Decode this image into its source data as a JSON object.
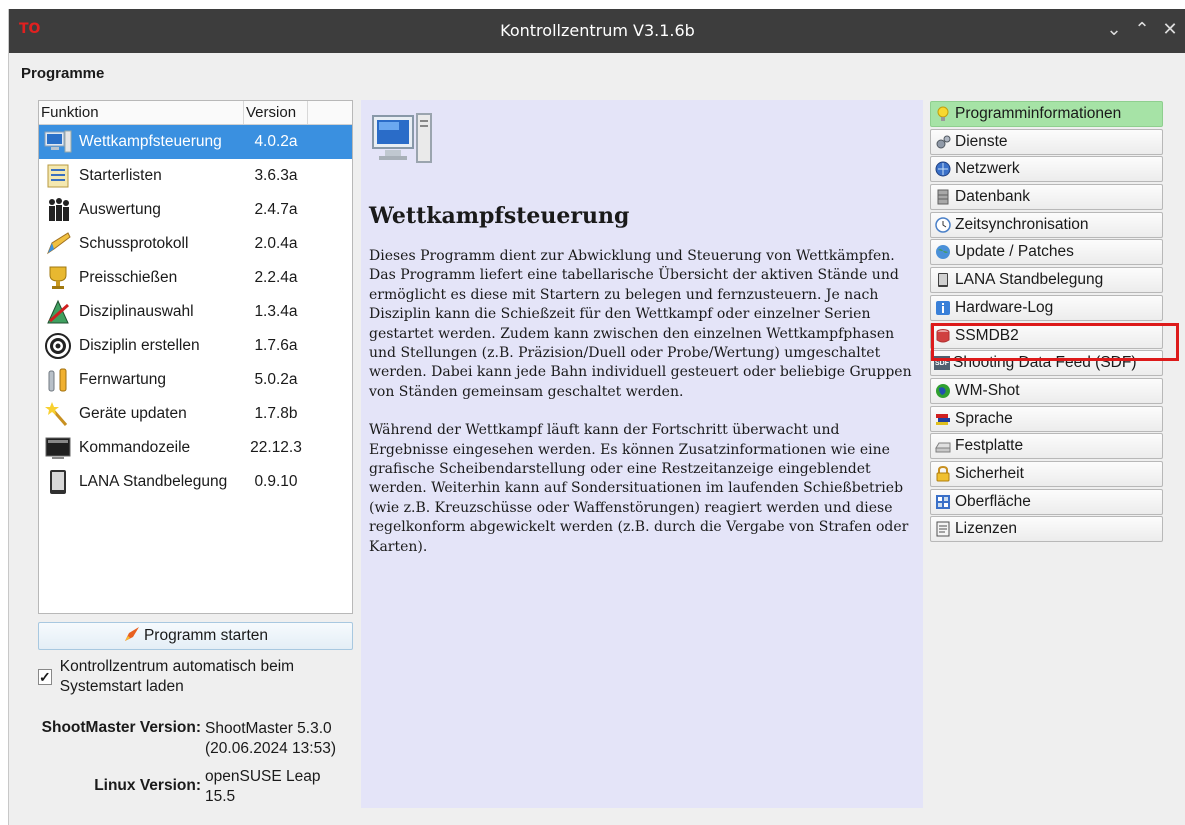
{
  "window": {
    "title": "Kontrollzentrum V3.1.6b",
    "app_icon_text": "TO",
    "controls": [
      "⌄",
      "⌃",
      "✕"
    ]
  },
  "group_title": "Programme",
  "program_list": {
    "headers": {
      "function": "Funktion",
      "version": "Version"
    },
    "rows": [
      {
        "name": "Wettkampfsteuerung",
        "version": "4.0.2a",
        "icon": "computer-icon",
        "selected": true
      },
      {
        "name": "Starterlisten",
        "version": "3.6.3a",
        "icon": "list-icon"
      },
      {
        "name": "Auswertung",
        "version": "2.4.7a",
        "icon": "podium-icon"
      },
      {
        "name": "Schussprotokoll",
        "version": "2.0.4a",
        "icon": "pencil-icon"
      },
      {
        "name": "Preisschießen",
        "version": "2.2.4a",
        "icon": "trophy-icon"
      },
      {
        "name": "Disziplinauswahl",
        "version": "1.3.4a",
        "icon": "target-arrow-icon"
      },
      {
        "name": "Disziplin erstellen",
        "version": "1.7.6a",
        "icon": "target-icon"
      },
      {
        "name": "Fernwartung",
        "version": "5.0.2a",
        "icon": "wrench-icon"
      },
      {
        "name": "Geräte updaten",
        "version": "1.7.8b",
        "icon": "magic-wand-icon"
      },
      {
        "name": "Kommandozeile",
        "version": "22.12.3",
        "icon": "terminal-icon"
      },
      {
        "name": "LANA Standbelegung",
        "version": "0.9.10",
        "icon": "tablet-icon"
      }
    ]
  },
  "start_button": "Programm starten",
  "autostart": {
    "label": "Kontrollzentrum automatisch beim Systemstart laden",
    "checked": true
  },
  "shootmaster": {
    "label": "ShootMaster Version:",
    "value_line1": "ShootMaster 5.3.0",
    "value_line2": "(20.06.2024 13:53)"
  },
  "linux": {
    "label": "Linux Version:",
    "value_line1": "openSUSE Leap",
    "value_line2": "15.5"
  },
  "info": {
    "title": "Wettkampfsteuerung",
    "paragraph1": "Dieses Programm dient zur Abwicklung und Steuerung von Wettkämpfen. Das Programm liefert eine tabellarische Übersicht der aktiven Stände und ermöglicht es diese mit Startern zu belegen und fernzusteuern. Je nach Disziplin kann die Schießzeit für den Wettkampf oder einzelner Serien gestartet werden. Zudem kann zwischen den einzelnen Wettkampfphasen und Stellungen (z.B. Präzision/Duell oder Probe/Wertung) umgeschaltet werden. Dabei kann jede Bahn individuell gesteuert oder beliebige Gruppen von Ständen gemeinsam geschaltet werden.",
    "paragraph2": "Während der Wettkampf läuft kann der Fortschritt überwacht und Ergebnisse eingesehen werden. Es können Zusatzinformationen wie eine grafische Scheibendarstellung oder eine Restzeitanzeige eingeblendet werden. Weiterhin kann auf Sondersituationen im laufenden Schießbetrieb (wie z.B. Kreuzschüsse oder Waffenstörungen) reagiert werden und diese regelkonform abgewickelt werden (z.B. durch die Vergabe von Strafen oder Karten)."
  },
  "side_buttons": [
    {
      "label": "Programminformationen",
      "icon": "lightbulb-icon",
      "active": true
    },
    {
      "label": "Dienste",
      "icon": "gears-icon"
    },
    {
      "label": "Netzwerk",
      "icon": "network-icon"
    },
    {
      "label": "Datenbank",
      "icon": "database-icon"
    },
    {
      "label": "Zeitsynchronisation",
      "icon": "clock-icon"
    },
    {
      "label": "Update / Patches",
      "icon": "globe-icon"
    },
    {
      "label": "LANA Standbelegung",
      "icon": "tablet-icon"
    },
    {
      "label": "Hardware-Log",
      "icon": "info-icon"
    },
    {
      "label": "SSMDB2",
      "icon": "database-red-icon"
    },
    {
      "label": "Shooting Data Feed (SDF)",
      "icon": "sdf-icon",
      "icon_text": "SDF"
    },
    {
      "label": "WM-Shot",
      "icon": "world-icon"
    },
    {
      "label": "Sprache",
      "icon": "flags-icon"
    },
    {
      "label": "Festplatte",
      "icon": "harddisk-icon"
    },
    {
      "label": "Sicherheit",
      "icon": "lock-icon"
    },
    {
      "label": "Oberfläche",
      "icon": "desktop-icon"
    },
    {
      "label": "Lizenzen",
      "icon": "license-icon"
    }
  ],
  "colors": {
    "selection": "#3a90e0",
    "active_button": "#a6e3a6",
    "highlight": "#dd1a1a",
    "info_bg": "#e4e4f8"
  }
}
